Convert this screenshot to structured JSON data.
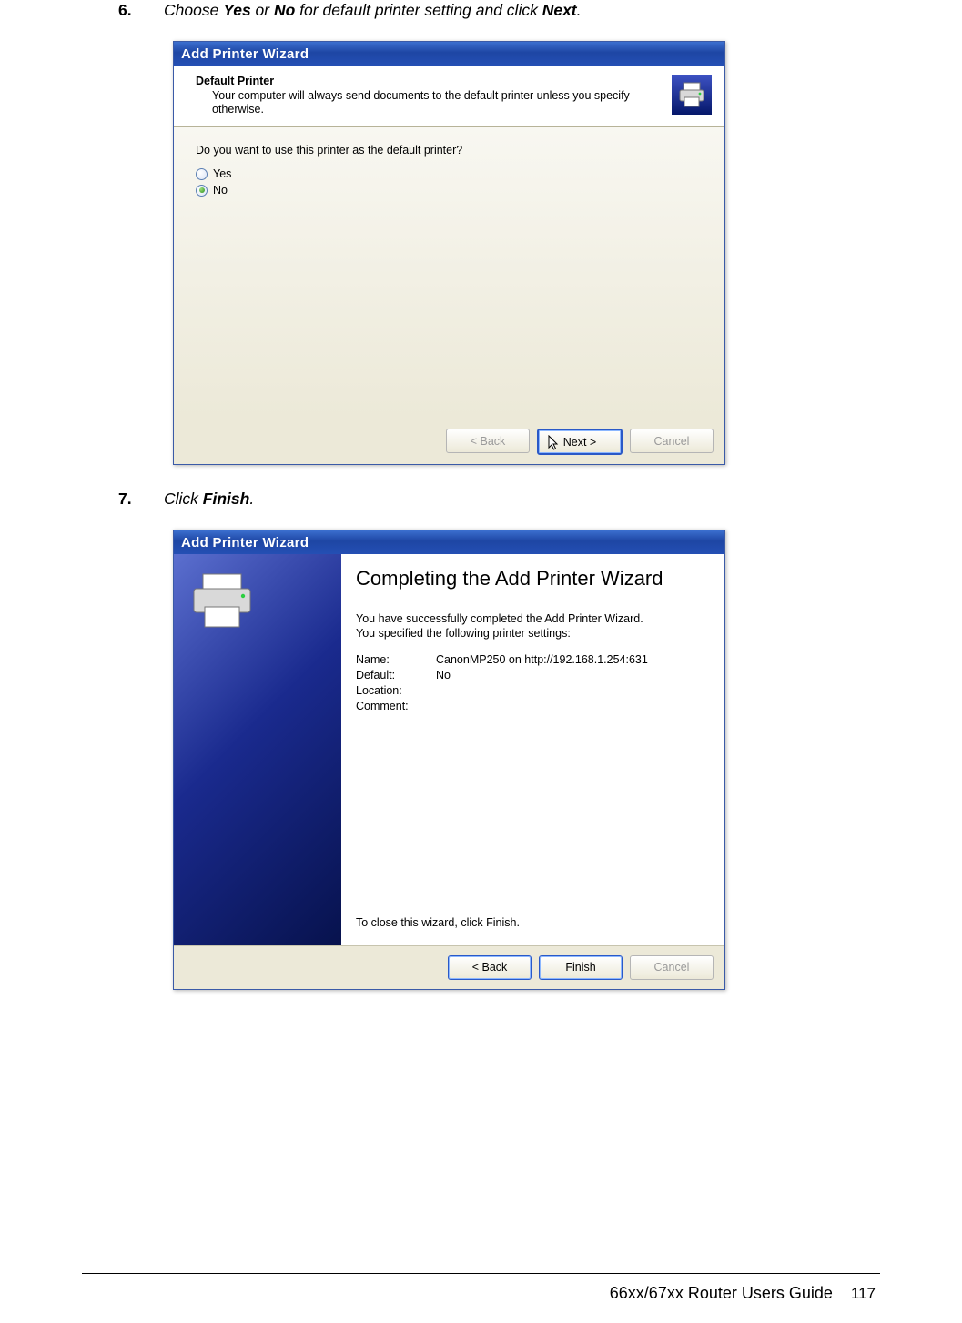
{
  "step6": {
    "num": "6.",
    "text_prefix": "Choose ",
    "yes": "Yes",
    "or": " or ",
    "no": "No",
    "mid": " for default printer setting and click ",
    "next": "Next",
    "suffix": "."
  },
  "step7": {
    "num": "7.",
    "text_prefix": "Click ",
    "finish": "Finish",
    "suffix": "."
  },
  "dialog6": {
    "title": "Add Printer Wizard",
    "heading": "Default Printer",
    "sub": "Your computer will always send documents to the default printer unless you specify otherwise.",
    "question": "Do you want to use this printer as the default printer?",
    "opt_yes": "Yes",
    "opt_no": "No",
    "btn_back": "< Back",
    "btn_next": "Next >",
    "btn_cancel": "Cancel"
  },
  "dialog7": {
    "title": "Add Printer Wizard",
    "heading": "Completing the Add Printer Wizard",
    "para1": "You have successfully completed the Add Printer Wizard.",
    "para2": "You specified the following printer settings:",
    "k_name": "Name:",
    "v_name": "CanonMP250 on http://192.168.1.254:631",
    "k_default": "Default:",
    "v_default": "No",
    "k_location": "Location:",
    "v_location": "",
    "k_comment": "Comment:",
    "v_comment": "",
    "close_hint": "To close this wizard, click Finish.",
    "btn_back": "< Back",
    "btn_finish": "Finish",
    "btn_cancel": "Cancel"
  },
  "footer": {
    "guide": "66xx/67xx Router Users Guide",
    "page": "117"
  }
}
